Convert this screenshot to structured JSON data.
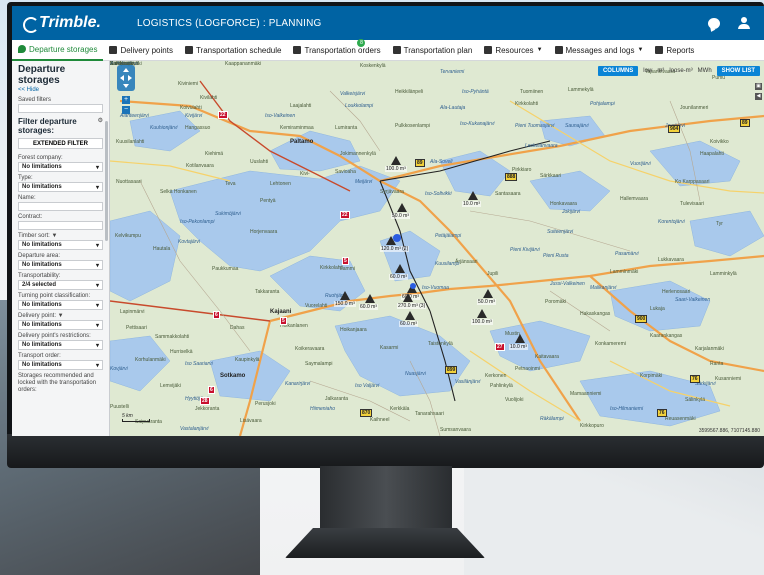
{
  "app": {
    "logo": "Trimble.",
    "title": "LOGISTICS (LOGFORCE) : PLANNING"
  },
  "nav": [
    {
      "label": "Departure storages",
      "active": true,
      "icon": "storage-icon"
    },
    {
      "label": "Delivery points",
      "icon": "route-icon"
    },
    {
      "label": "Transportation schedule",
      "icon": "schedule-icon"
    },
    {
      "label": "Transportation orders",
      "icon": "orders-icon",
      "badge": "8"
    },
    {
      "label": "Transportation plan",
      "icon": "plan-icon"
    },
    {
      "label": "Resources",
      "icon": "resources-icon",
      "dropdown": true
    },
    {
      "label": "Messages and logs",
      "icon": "messages-icon",
      "dropdown": true
    },
    {
      "label": "Reports",
      "icon": "reports-icon"
    }
  ],
  "panel": {
    "title": "Departure storages",
    "hide": "<< Hide",
    "saved_filters": "Saved filters",
    "filter_heading": "Filter departure storages:",
    "extended_filter": "EXTENDED FILTER",
    "fields": [
      {
        "label": "Forest company:",
        "value": "No limitations",
        "type": "select"
      },
      {
        "label": "Type:",
        "value": "No limitations",
        "type": "select"
      },
      {
        "label": "Name:",
        "value": "",
        "type": "input"
      },
      {
        "label": "Contract:",
        "value": "",
        "type": "input"
      },
      {
        "label": "Timber sort: ▼",
        "value": "No limitations",
        "type": "select"
      },
      {
        "label": "Departure area:",
        "value": "No limitations",
        "type": "select"
      },
      {
        "label": "Transportability:",
        "value": "2/4 selected",
        "type": "select"
      },
      {
        "label": "Turning point classification:",
        "value": "No limitations",
        "type": "select"
      },
      {
        "label": "Delivery point: ▼",
        "value": "No limitations",
        "type": "select"
      },
      {
        "label": "Delivery point's restrictions:",
        "value": "No limitations",
        "type": "select"
      },
      {
        "label": "Transport order:",
        "value": "No limitations",
        "type": "select"
      }
    ],
    "footer_note": "Storages recommended and locked with the transportation orders:"
  },
  "map": {
    "columns_btn": "COLUMNS",
    "unit_toggle": [
      "low",
      "m³",
      "loose-m³",
      "MWh"
    ],
    "show_list_btn": "SHOW LIST",
    "scale": "5 km",
    "coords": "3599567.886, 7107145.880",
    "places": [
      {
        "t": "Kaappananmäki",
        "c": ""
      },
      {
        "t": "Kiviniemi",
        "c": ""
      },
      {
        "t": "Koskenkylä",
        "c": ""
      },
      {
        "t": "Tervaniemi",
        "c": "i"
      },
      {
        "t": "Tapaninvaara",
        "c": ""
      },
      {
        "t": "Pumu",
        "c": ""
      },
      {
        "t": "Kivilahti",
        "c": ""
      },
      {
        "t": "Valkeisjärvi",
        "c": "i"
      },
      {
        "t": "Heikkilänpeli",
        "c": ""
      },
      {
        "t": "Iso-Pyhäntä",
        "c": "i"
      },
      {
        "t": "Tuomiinen",
        "c": ""
      },
      {
        "t": "Lammekylä",
        "c": ""
      },
      {
        "t": "Koivulahti",
        "c": ""
      },
      {
        "t": "Laajalahti",
        "c": ""
      },
      {
        "t": "Loukkolampi",
        "c": "i"
      },
      {
        "t": "Ala-Lautaja",
        "c": "i"
      },
      {
        "t": "Kirkkolahti",
        "c": ""
      },
      {
        "t": "Pohjalampi",
        "c": "i"
      },
      {
        "t": "Jounilanmeri",
        "c": ""
      },
      {
        "t": "Alanteenjärvi",
        "c": "i"
      },
      {
        "t": "Kivijärvi",
        "c": "i"
      },
      {
        "t": "Iso-Valkeinen",
        "c": "i"
      },
      {
        "t": "Pulkkosenlampi",
        "c": ""
      },
      {
        "t": "Iso-Kukanajärvi",
        "c": "i"
      },
      {
        "t": "Kuuhionjärvi",
        "c": "i"
      },
      {
        "t": "Hangassuo",
        "c": ""
      },
      {
        "t": "Kemiraminmaa",
        "c": ""
      },
      {
        "t": "Lumiranta",
        "c": ""
      },
      {
        "t": "Pieni Tuomasjärvi",
        "c": "i"
      },
      {
        "t": "Saunajärvi",
        "c": "i"
      },
      {
        "t": "Jaurijärvi",
        "c": "i"
      },
      {
        "t": "Kuusilanlahti",
        "c": ""
      },
      {
        "t": "Paltamo",
        "c": "b"
      },
      {
        "t": "Koivikko",
        "c": ""
      },
      {
        "t": "Kiehimä",
        "c": ""
      },
      {
        "t": "Jokimannenkylä",
        "c": ""
      },
      {
        "t": "Leskelänvaara",
        "c": "i"
      },
      {
        "t": "Haapalahti",
        "c": ""
      },
      {
        "t": "Kotilanvaara",
        "c": ""
      },
      {
        "t": "Uuslahti",
        "c": ""
      },
      {
        "t": "Savioaha",
        "c": ""
      },
      {
        "t": "Meijärvi",
        "c": "i"
      },
      {
        "t": "Ala-Soveli",
        "c": "i"
      },
      {
        "t": "Särkkaari",
        "c": ""
      },
      {
        "t": "Vuorijärvi",
        "c": "i"
      },
      {
        "t": "Ko Karppasaari",
        "c": ""
      },
      {
        "t": "Nuottasaari",
        "c": ""
      },
      {
        "t": "Teva",
        "c": ""
      },
      {
        "t": "Lehtonen",
        "c": ""
      },
      {
        "t": "Kivi-",
        "c": ""
      },
      {
        "t": "Syrjävaara",
        "c": ""
      },
      {
        "t": "Iso-Soltvikki",
        "c": "i"
      },
      {
        "t": "Pirkkiaro",
        "c": ""
      },
      {
        "t": "Selkä Honkanen",
        "c": ""
      },
      {
        "t": "Pentyä",
        "c": ""
      },
      {
        "t": "Santasaara",
        "c": ""
      },
      {
        "t": "Honkavaara",
        "c": ""
      },
      {
        "t": "Hallemvaara",
        "c": ""
      },
      {
        "t": "Tulevisaari",
        "c": ""
      },
      {
        "t": "Sukimöjärvi",
        "c": "i"
      },
      {
        "t": "Jokijärvi",
        "c": "i"
      },
      {
        "t": "Korentojärvi",
        "c": "i"
      },
      {
        "t": "Tyr",
        "c": ""
      },
      {
        "t": "Iso-Pekonlampi",
        "c": "i"
      },
      {
        "t": "Horjenvaara",
        "c": ""
      },
      {
        "t": "Petäjälampi",
        "c": "i"
      },
      {
        "t": "Suiteenjärvi",
        "c": "i"
      },
      {
        "t": "Kelvikumpu",
        "c": ""
      },
      {
        "t": "Kovtajärvi",
        "c": "i"
      },
      {
        "t": "Pieni Kivijärvi",
        "c": "i"
      },
      {
        "t": "Pieni Rusta",
        "c": "i"
      },
      {
        "t": "Pasamärvi",
        "c": "i"
      },
      {
        "t": "Lukkavaara",
        "c": ""
      },
      {
        "t": "Ärjänsaari",
        "c": ""
      },
      {
        "t": "Kirkkolahti",
        "c": ""
      },
      {
        "t": "Hautala",
        "c": ""
      },
      {
        "t": "Paukkumaa",
        "c": ""
      },
      {
        "t": "Lammi",
        "c": ""
      },
      {
        "t": "Kuusilampi",
        "c": "i"
      },
      {
        "t": "Jupili",
        "c": ""
      },
      {
        "t": "Lamminkylä",
        "c": ""
      },
      {
        "t": "Lamminmäki",
        "c": ""
      },
      {
        "t": "Jussi-Valkeinen",
        "c": "i"
      },
      {
        "t": "Herlenosaari",
        "c": ""
      },
      {
        "t": "Takkaranta",
        "c": ""
      },
      {
        "t": "Ruohjärvi",
        "c": "i"
      },
      {
        "t": "Iso-Vuomaa",
        "c": "i"
      },
      {
        "t": "Malikanjärvi",
        "c": "i"
      },
      {
        "t": "Saari-Valkeinen",
        "c": "i"
      },
      {
        "t": "Lapinmärvi",
        "c": ""
      },
      {
        "t": "Kajaani",
        "c": "b"
      },
      {
        "t": "Vuorelahti",
        "c": ""
      },
      {
        "t": "Poromäki",
        "c": ""
      },
      {
        "t": "Lukaja",
        "c": ""
      },
      {
        "t": "Pettisaari",
        "c": ""
      },
      {
        "t": "Hoikanlanen",
        "c": ""
      },
      {
        "t": "Hakaskangas",
        "c": ""
      },
      {
        "t": "Sammakkolahti",
        "c": ""
      },
      {
        "t": "Dahas",
        "c": ""
      },
      {
        "t": "Hoikanjaara",
        "c": ""
      },
      {
        "t": "Mustin",
        "c": ""
      },
      {
        "t": "Konkameremi",
        "c": ""
      },
      {
        "t": "Hurriselkä",
        "c": ""
      },
      {
        "t": "Koikeravaara",
        "c": ""
      },
      {
        "t": "Kaupinkylä",
        "c": ""
      },
      {
        "t": "Kasarmi",
        "c": ""
      },
      {
        "t": "Kaarankangas",
        "c": ""
      },
      {
        "t": "Korhulanmäki",
        "c": ""
      },
      {
        "t": "Karjalanmäki",
        "c": ""
      },
      {
        "t": "Kovjärvi",
        "c": "i"
      },
      {
        "t": "Iso Saariarvi",
        "c": "i"
      },
      {
        "t": "Kaitavaara",
        "c": ""
      },
      {
        "t": "Petnaoinmi",
        "c": ""
      },
      {
        "t": "Ranta",
        "c": ""
      },
      {
        "t": "Lemvijäki",
        "c": ""
      },
      {
        "t": "Kanarirjärvi",
        "c": "i"
      },
      {
        "t": "Sotkamo",
        "c": "b"
      },
      {
        "t": "Korpimäki",
        "c": ""
      },
      {
        "t": "Vasilänjärvi",
        "c": "i"
      },
      {
        "t": "Kerkonen",
        "c": ""
      },
      {
        "t": "Nuasjärvi",
        "c": "i"
      },
      {
        "t": "Taistonkylä",
        "c": ""
      },
      {
        "t": "Kusanniemi",
        "c": ""
      },
      {
        "t": "Perusjoki",
        "c": ""
      },
      {
        "t": "Iso Valjärvi",
        "c": "i"
      },
      {
        "t": "Pahlinkylä",
        "c": ""
      },
      {
        "t": "Sälinkylä",
        "c": ""
      },
      {
        "t": "Puustelli",
        "c": ""
      },
      {
        "t": "Jekkoranta",
        "c": ""
      },
      {
        "t": "Hiimeniaho",
        "c": "i"
      },
      {
        "t": "Iso-Hilmaniemi",
        "c": "i"
      },
      {
        "t": "Saipuaranta",
        "c": ""
      },
      {
        "t": "Vuolijoki",
        "c": ""
      },
      {
        "t": "Särkijärvi",
        "c": "i"
      },
      {
        "t": "Vastalanjärvi",
        "c": "i"
      },
      {
        "t": "Sumsanvaara",
        "c": ""
      },
      {
        "t": "Reuasenmäki",
        "c": ""
      },
      {
        "t": "Jalkaranta",
        "c": ""
      },
      {
        "t": "Kirkkopuro",
        "c": ""
      },
      {
        "t": "Saymalampi",
        "c": ""
      },
      {
        "t": "Tanarahsaari",
        "c": ""
      },
      {
        "t": "Hyytiöjärvi",
        "c": "i"
      },
      {
        "t": "Räkälampi",
        "c": "i"
      },
      {
        "t": "Lisävaara",
        "c": ""
      },
      {
        "t": "Kerkkäla",
        "c": ""
      },
      {
        "t": "Kaihneel",
        "c": ""
      },
      {
        "t": "Mamaanniemi",
        "c": ""
      },
      {
        "t": "Vansvaara",
        "c": ""
      },
      {
        "t": "Kärkkäänmäki",
        "c": ""
      },
      {
        "t": "Koirakivijärvi",
        "c": "i"
      },
      {
        "t": "Arviojärvi",
        "c": "i"
      },
      {
        "t": "Kalkkimäki",
        "c": ""
      },
      {
        "t": "Sukhiminkylä",
        "c": ""
      }
    ],
    "road_shields": [
      {
        "t": "22",
        "c": "red"
      },
      {
        "t": "89",
        "c": "yel"
      },
      {
        "t": "904",
        "c": "yel"
      },
      {
        "t": "89",
        "c": "yel"
      },
      {
        "t": "888",
        "c": "yel"
      },
      {
        "t": "22",
        "c": "red"
      },
      {
        "t": "5",
        "c": "red"
      },
      {
        "t": "900",
        "c": "yel"
      },
      {
        "t": "6",
        "c": "red"
      },
      {
        "t": "5",
        "c": "red"
      },
      {
        "t": "28",
        "c": "red"
      },
      {
        "t": "899",
        "c": "yel"
      },
      {
        "t": "76",
        "c": "yel"
      },
      {
        "t": "870",
        "c": "yel"
      },
      {
        "t": "76",
        "c": "yel"
      },
      {
        "t": "6",
        "c": "red"
      },
      {
        "t": "27",
        "c": "red"
      }
    ],
    "storages": [
      {
        "volume": "100.0 m³"
      },
      {
        "volume": "50.0 m³"
      },
      {
        "volume": "10.0 m³"
      },
      {
        "volume": "120.0 m³ (2)"
      },
      {
        "volume": "60.0 m³"
      },
      {
        "volume": "60.0 m³"
      },
      {
        "volume": "270.0 m³ (3)"
      },
      {
        "volume": "150.0 m³"
      },
      {
        "volume": "60.0 m³"
      },
      {
        "volume": "60.0 m³"
      },
      {
        "volume": "50.0 m³"
      },
      {
        "volume": "100.0 m³"
      },
      {
        "volume": "10.0 m³"
      }
    ]
  }
}
